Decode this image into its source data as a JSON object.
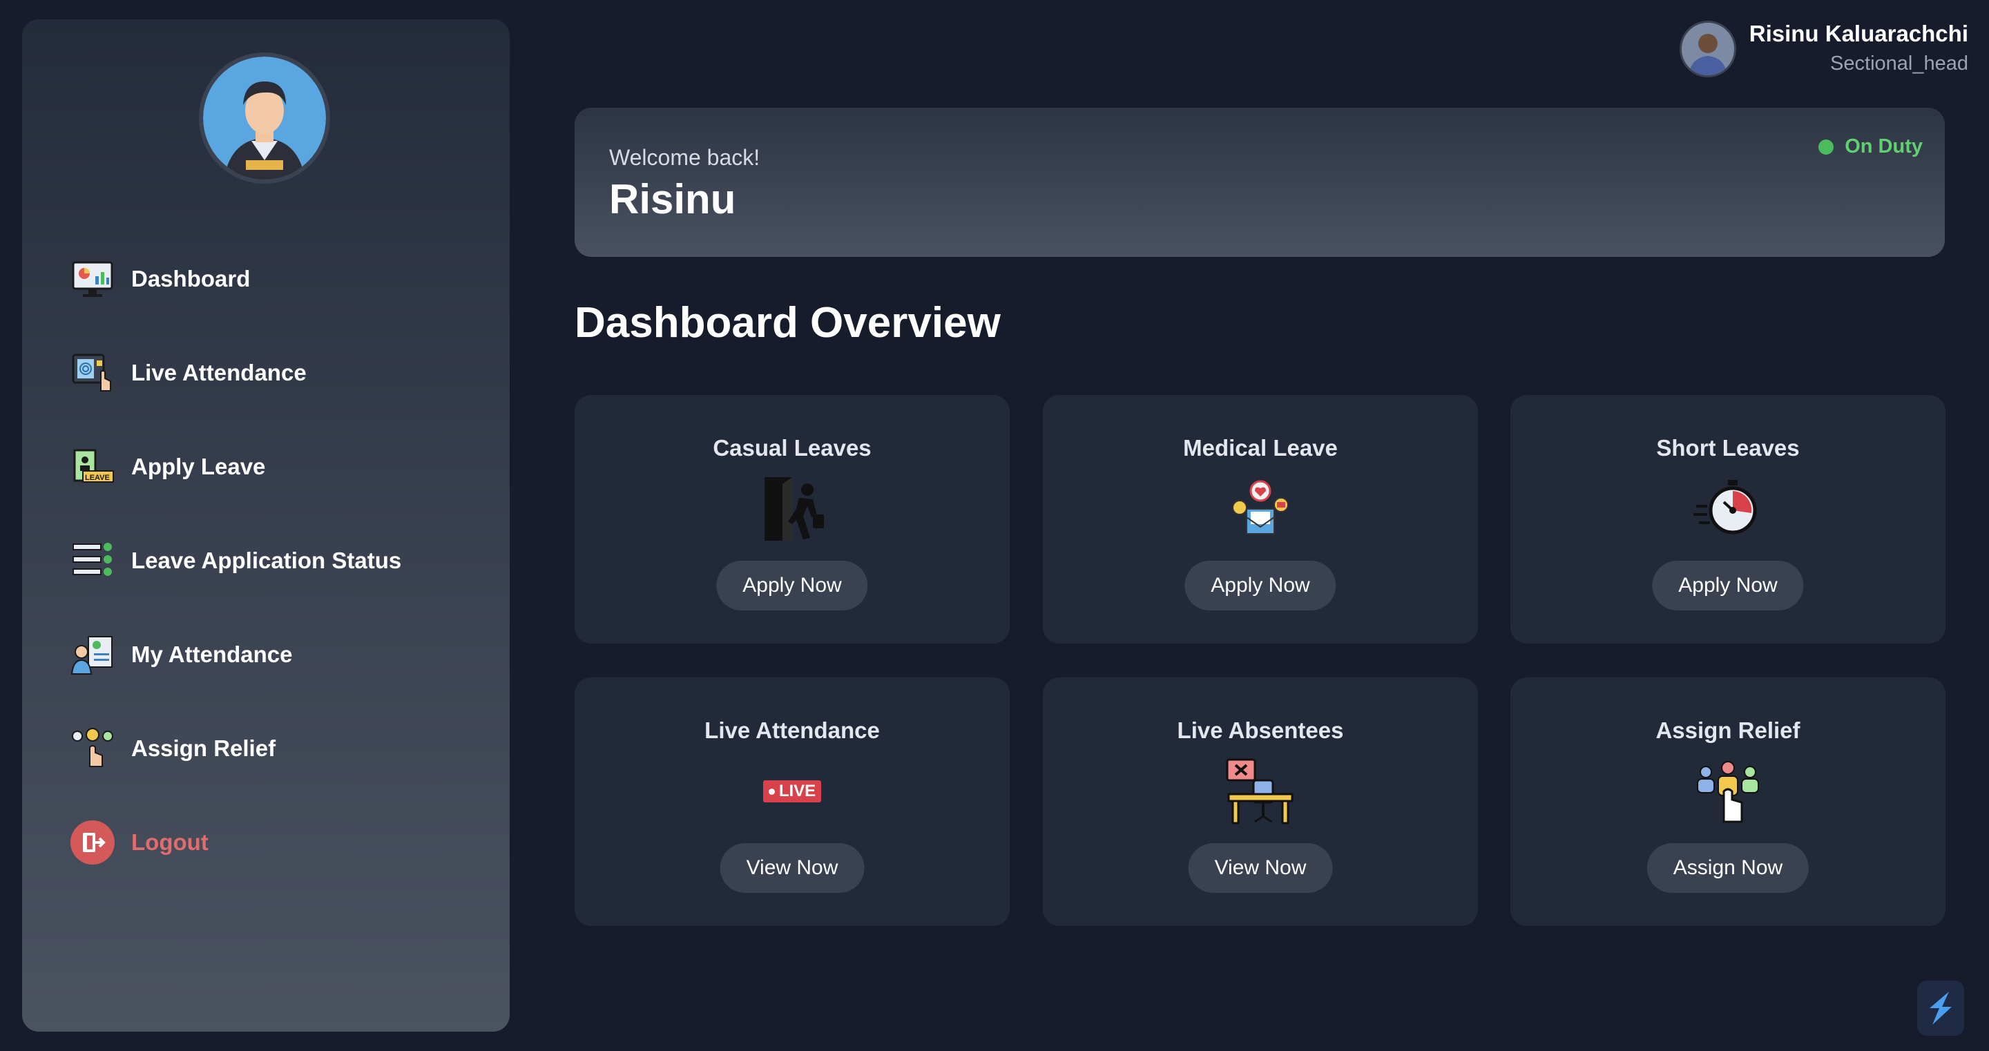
{
  "sidebar": {
    "items": [
      {
        "label": "Dashboard",
        "icon": "dashboard-monitor-icon"
      },
      {
        "label": "Live Attendance",
        "icon": "fingerprint-scan-icon"
      },
      {
        "label": "Apply Leave",
        "icon": "leave-document-icon"
      },
      {
        "label": "Leave Application Status",
        "icon": "status-list-icon"
      },
      {
        "label": "My Attendance",
        "icon": "attendance-person-icon"
      },
      {
        "label": "Assign Relief",
        "icon": "assign-people-icon"
      }
    ],
    "logout_label": "Logout"
  },
  "user": {
    "name": "Risinu Kaluarachchi",
    "role": "Sectional_head"
  },
  "welcome": {
    "subtitle": "Welcome back!",
    "name": "Risinu",
    "status": "On Duty",
    "status_color": "#5fd26e"
  },
  "overview": {
    "title": "Dashboard Overview",
    "cards": [
      {
        "title": "Casual Leaves",
        "button": "Apply Now",
        "icon": "exit-door-icon"
      },
      {
        "title": "Medical Leave",
        "button": "Apply Now",
        "icon": "medical-mail-icon"
      },
      {
        "title": "Short Leaves",
        "button": "Apply Now",
        "icon": "stopwatch-icon"
      },
      {
        "title": "Live Attendance",
        "button": "View Now",
        "icon": "live-badge-icon",
        "badge": "LIVE"
      },
      {
        "title": "Live Absentees",
        "button": "View Now",
        "icon": "empty-desk-icon"
      },
      {
        "title": "Assign Relief",
        "button": "Assign Now",
        "icon": "assign-hand-icon"
      }
    ]
  },
  "colors": {
    "background": "#161c2c",
    "card": "#222938",
    "button": "#3a4150",
    "logout": "#e06c6c"
  }
}
